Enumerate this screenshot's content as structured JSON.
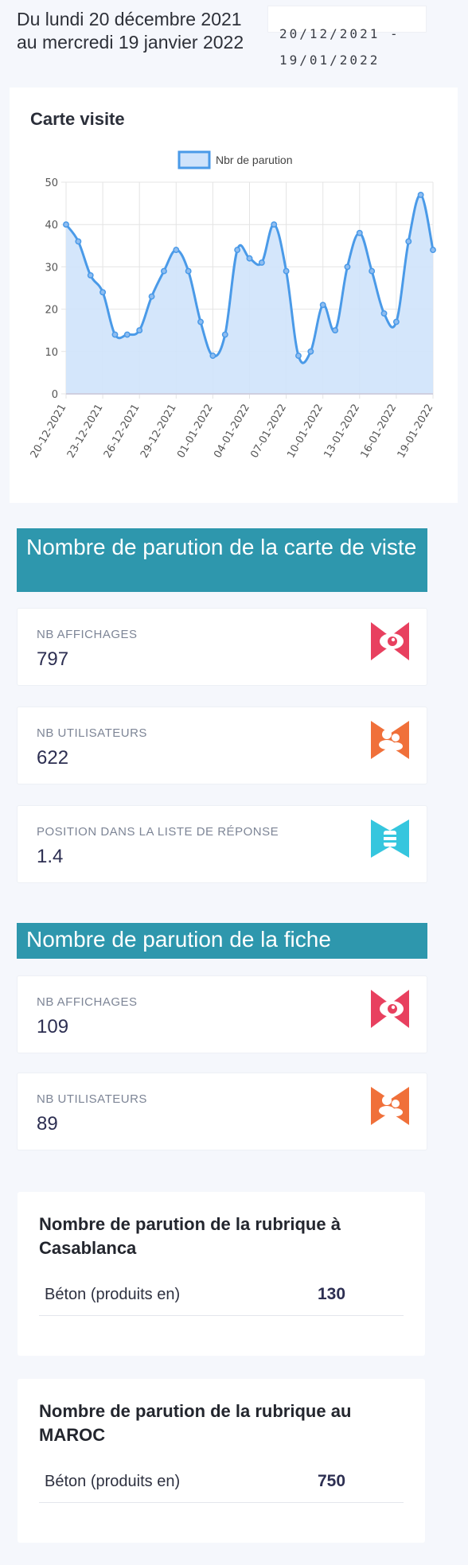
{
  "header": {
    "period_text": "Du lundi 20 décembre 2021 au mercredi 19 janvier 2022",
    "date_range": "20/12/2021 - 19/01/2022"
  },
  "chart_card": {
    "title": "Carte visite"
  },
  "chart_data": {
    "type": "line",
    "title": "Carte visite",
    "legend": [
      "Nbr de parution"
    ],
    "legend_position": "top",
    "x_tick_labels": [
      "20-12-2021",
      "23-12-2021",
      "26-12-2021",
      "29-12-2021",
      "01-01-2022",
      "04-01-2022",
      "07-01-2022",
      "10-01-2022",
      "13-01-2022",
      "16-01-2022",
      "19-01-2022"
    ],
    "x": [
      "20-12-2021",
      "21-12-2021",
      "22-12-2021",
      "23-12-2021",
      "24-12-2021",
      "25-12-2021",
      "26-12-2021",
      "27-12-2021",
      "28-12-2021",
      "29-12-2021",
      "30-12-2021",
      "31-12-2021",
      "01-01-2022",
      "02-01-2022",
      "03-01-2022",
      "04-01-2022",
      "05-01-2022",
      "06-01-2022",
      "07-01-2022",
      "08-01-2022",
      "09-01-2022",
      "10-01-2022",
      "11-01-2022",
      "12-01-2022",
      "13-01-2022",
      "14-01-2022",
      "15-01-2022",
      "16-01-2022",
      "17-01-2022",
      "18-01-2022",
      "19-01-2022"
    ],
    "series": [
      {
        "name": "Nbr de parution",
        "values": [
          40,
          36,
          28,
          24,
          14,
          14,
          15,
          23,
          29,
          34,
          29,
          17,
          9,
          14,
          34,
          32,
          31,
          40,
          29,
          9,
          10,
          21,
          15,
          30,
          38,
          29,
          19,
          17,
          36,
          47,
          34
        ]
      }
    ],
    "ylim": [
      0,
      50
    ],
    "y_ticks": [
      0,
      10,
      20,
      30,
      40,
      50
    ],
    "grid": true,
    "line_color": "#4a9ae8",
    "fill_color": "#cfe3fb"
  },
  "section_carte": {
    "title": "Nombre de parution de la carte de viste",
    "stats": [
      {
        "label": "NB AFFICHAGES",
        "value": "797",
        "icon": "eye-icon",
        "color": "#e8405f"
      },
      {
        "label": "NB UTILISATEURS",
        "value": "622",
        "icon": "users-icon",
        "color": "#f0703a"
      },
      {
        "label": "POSITION DANS LA LISTE DE RÉPONSE",
        "value": "1.4",
        "icon": "list-icon",
        "color": "#35c6de"
      }
    ]
  },
  "section_fiche": {
    "title": "Nombre de parution de la fiche",
    "stats": [
      {
        "label": "NB AFFICHAGES",
        "value": "109",
        "icon": "eye-icon",
        "color": "#e8405f"
      },
      {
        "label": "NB UTILISATEURS",
        "value": "89",
        "icon": "users-icon",
        "color": "#f0703a"
      }
    ]
  },
  "rubric_casablanca": {
    "title": "Nombre de parution de la rubrique à Casablanca",
    "rows": [
      {
        "name": "Béton (produits en)",
        "count": "130"
      }
    ]
  },
  "rubric_maroc": {
    "title": "Nombre de parution de la rubrique au MAROC",
    "rows": [
      {
        "name": "Béton (produits en)",
        "count": "750"
      }
    ]
  }
}
